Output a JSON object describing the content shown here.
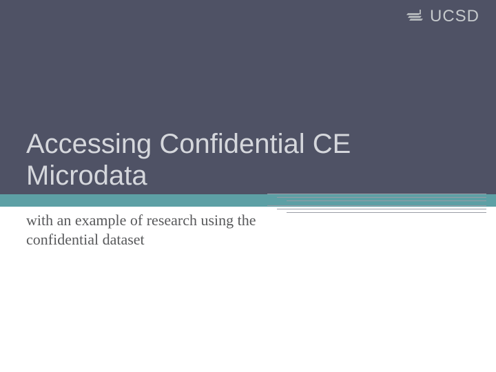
{
  "logo": {
    "text": "UCSD"
  },
  "slide": {
    "title": "Accessing Confidential CE Microdata",
    "subtitle": "with an example of research using the confidential dataset"
  },
  "colors": {
    "panel": "#4f5265",
    "accent": "#5da0a5",
    "title_text": "#d5d7dc",
    "subtitle_text": "#58595b"
  }
}
